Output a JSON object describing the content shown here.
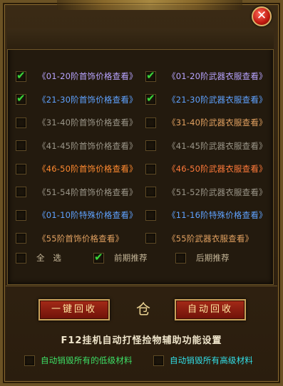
{
  "window": {
    "close_glyph": "✕"
  },
  "options_left": [
    {
      "label": "《01-20阶首饰价格查看》",
      "checked": true,
      "color": "#b8a4ff"
    },
    {
      "label": "《21-30阶首饰价格查看》",
      "checked": true,
      "color": "#5fa2ff"
    },
    {
      "label": "《31-40阶首饰价格查看》",
      "checked": false,
      "color": "#9a9588"
    },
    {
      "label": "《41-45阶首饰价格查看》",
      "checked": false,
      "color": "#9a9588"
    },
    {
      "label": "《46-50阶首饰价格查看》",
      "checked": false,
      "color": "#ff8a30"
    },
    {
      "label": "《51-54阶首饰价格查看》",
      "checked": false,
      "color": "#9a9588"
    },
    {
      "label": "《01-10阶特殊价格查看》",
      "checked": false,
      "color": "#5fa2ff"
    },
    {
      "label": "《55阶首饰价格查看》",
      "checked": false,
      "color": "#e0a060"
    }
  ],
  "options_right": [
    {
      "label": "《01-20阶武器衣服查看》",
      "checked": true,
      "color": "#b8a4ff"
    },
    {
      "label": "《21-30阶武器衣服查看》",
      "checked": true,
      "color": "#5fa2ff"
    },
    {
      "label": "《31-40阶武器衣服查看》",
      "checked": false,
      "color": "#e0a060"
    },
    {
      "label": "《41-45阶武器衣服查看》",
      "checked": false,
      "color": "#9a9588"
    },
    {
      "label": "《46-50阶武器衣服查看》",
      "checked": false,
      "color": "#ff7a3a"
    },
    {
      "label": "《51-52阶武器衣服查看》",
      "checked": false,
      "color": "#9a9588"
    },
    {
      "label": "《11-16阶特殊价格查看》",
      "checked": false,
      "color": "#5fa2ff"
    },
    {
      "label": "《55阶武器衣服查看》",
      "checked": false,
      "color": "#e0a060"
    }
  ],
  "select_row": {
    "select_all": {
      "label": "全　选",
      "checked": false
    },
    "early": {
      "label": "前期推荐",
      "checked": true
    },
    "late": {
      "label": "后期推荐",
      "checked": false
    }
  },
  "buttons": {
    "one_click_recycle": "一键回收",
    "auto_recycle": "自动回收",
    "lock_glyph": "仓"
  },
  "section": {
    "title": "F12挂机自动打怪捡物辅助功能设置",
    "destroy_low": {
      "label": "自动销毁所有的低级材料",
      "checked": false,
      "color": "#3de066"
    },
    "destroy_high": {
      "label": "自动销毁所有高级材料",
      "checked": false,
      "color": "#31e0e8"
    }
  }
}
